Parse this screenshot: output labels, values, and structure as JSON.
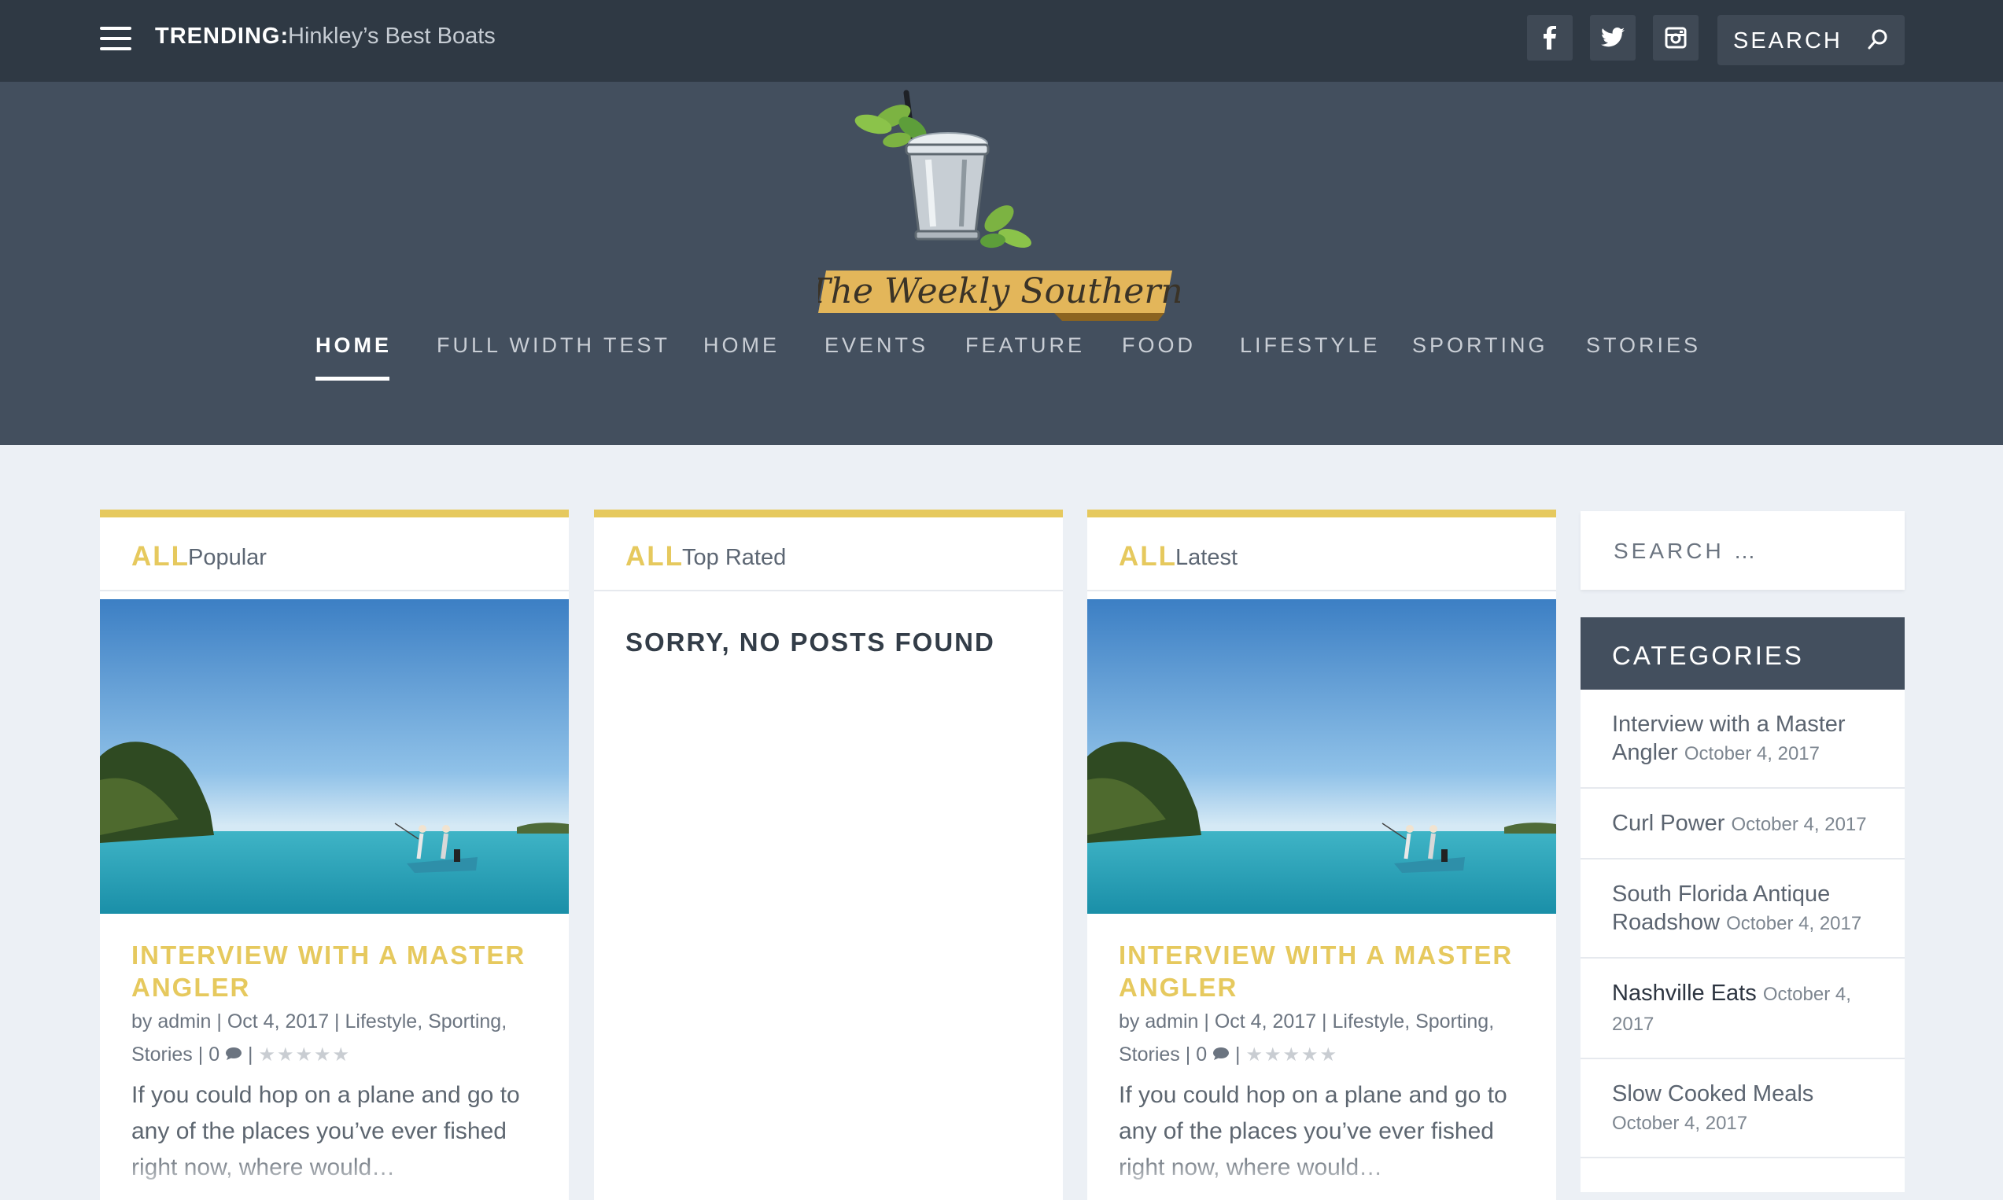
{
  "topbar": {
    "trending_label": "TRENDING:",
    "trending_text": "Hinkley’s Best Boats",
    "search_placeholder": "SEARCH",
    "social": [
      "facebook-icon",
      "twitter-icon",
      "instagram-icon"
    ]
  },
  "logo": {
    "text": "The Weekly Southern"
  },
  "nav": {
    "items": [
      "HOME",
      "FULL WIDTH TEST",
      "HOME",
      "EVENTS",
      "FEATURE",
      "FOOD",
      "LIFESTYLE",
      "SPORTING",
      "STORIES"
    ],
    "active": "HOME"
  },
  "cards": [
    {
      "all": "ALL",
      "sub": "Popular",
      "title": "INTERVIEW WITH A MASTER ANGLER",
      "meta": {
        "by": "by",
        "author": "admin",
        "date": "Oct 4, 2017",
        "categories": "Lifestyle, Sporting, Stories",
        "comments": "0"
      },
      "excerpt": "If you could hop on a plane and go to any of the places you’ve ever fished right now, where would…"
    },
    {
      "all": "ALL",
      "sub": "Top Rated",
      "empty": "SORRY, NO POSTS FOUND"
    },
    {
      "all": "ALL",
      "sub": "Latest",
      "title": "INTERVIEW WITH A MASTER ANGLER",
      "meta": {
        "by": "by",
        "author": "admin",
        "date": "Oct 4, 2017",
        "categories": "Lifestyle, Sporting, Stories",
        "comments": "0"
      },
      "excerpt": "If you could hop on a plane and go to any of the places you’ve ever fished right now, where would…"
    }
  ],
  "sidebar": {
    "search_placeholder": "SEARCH …",
    "categories_title": "CATEGORIES",
    "items": [
      {
        "title": "Interview with a Master Angler",
        "date": "October 4, 2017"
      },
      {
        "title": "Curl Power",
        "date": "October 4, 2017"
      },
      {
        "title": "South Florida Antique Roadshow",
        "date": "October 4, 2017"
      },
      {
        "title": "Nashville Eats",
        "date": "October 4, 2017"
      },
      {
        "title": "Slow Cooked Meals",
        "date": "October 4, 2017"
      }
    ]
  },
  "colors": {
    "topbar": "#2f3944",
    "header": "#434f5e",
    "accent": "#e6c95e",
    "background": "#ecf0f5"
  }
}
